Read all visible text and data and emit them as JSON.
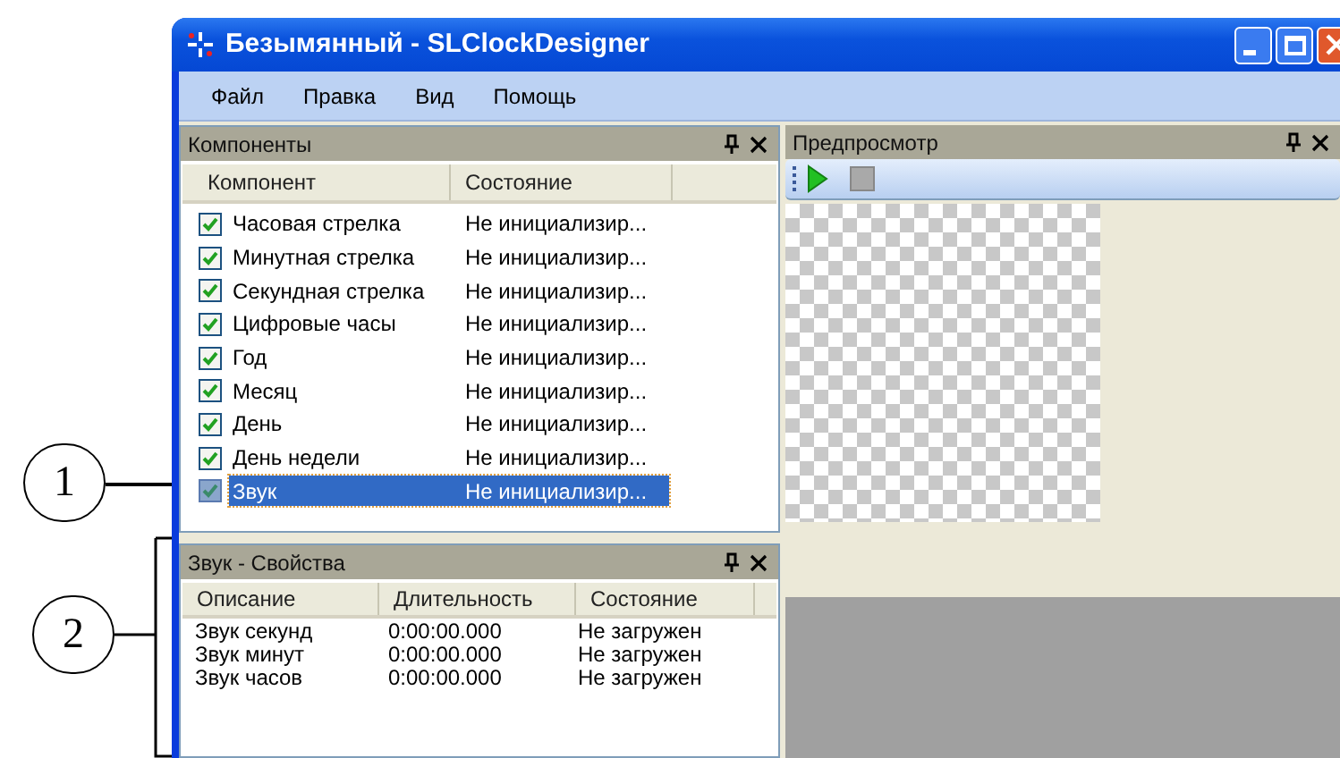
{
  "window": {
    "title": "Безымянный - SLClockDesigner"
  },
  "menu": [
    "Файл",
    "Правка",
    "Вид",
    "Помощь"
  ],
  "components_panel": {
    "title": "Компоненты",
    "columns": [
      "Компонент",
      "Состояние"
    ],
    "rows": [
      {
        "name": "Часовая стрелка",
        "status": "Не инициализир...",
        "checked": true,
        "selected": false
      },
      {
        "name": "Минутная стрелка",
        "status": "Не инициализир...",
        "checked": true,
        "selected": false
      },
      {
        "name": "Секундная стрелка",
        "status": "Не инициализир...",
        "checked": true,
        "selected": false
      },
      {
        "name": "Цифровые часы",
        "status": "Не инициализир...",
        "checked": true,
        "selected": false
      },
      {
        "name": "Год",
        "status": "Не инициализир...",
        "checked": true,
        "selected": false
      },
      {
        "name": "Месяц",
        "status": "Не инициализир...",
        "checked": true,
        "selected": false
      },
      {
        "name": "День",
        "status": "Не инициализир...",
        "checked": true,
        "selected": false
      },
      {
        "name": "День недели",
        "status": "Не инициализир...",
        "checked": true,
        "selected": false
      },
      {
        "name": "Звук",
        "status": "Не инициализир...",
        "checked": true,
        "selected": true
      }
    ]
  },
  "properties_panel": {
    "title": "Звук - Свойства",
    "columns": [
      "Описание",
      "Длительность",
      "Состояние"
    ],
    "rows": [
      {
        "description": "Звук секунд",
        "duration": "0:00:00.000",
        "status": "Не загружен"
      },
      {
        "description": "Звук минут",
        "duration": "0:00:00.000",
        "status": "Не загружен"
      },
      {
        "description": "Звук часов",
        "duration": "0:00:00.000",
        "status": "Не загружен"
      }
    ]
  },
  "preview_panel": {
    "title": "Предпросмотр"
  },
  "callouts": [
    "1",
    "2"
  ]
}
